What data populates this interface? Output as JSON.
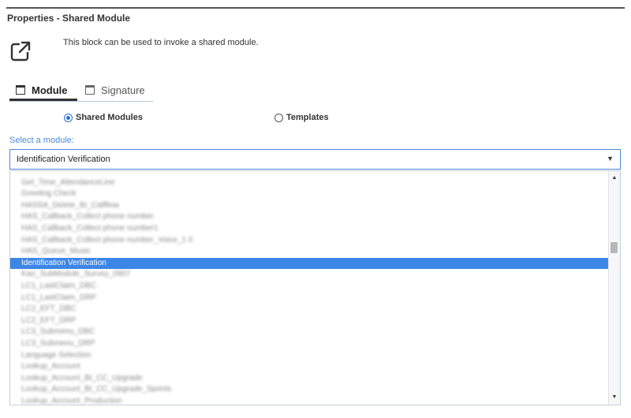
{
  "panel": {
    "title": "Properties - Shared Module",
    "description": "This block can be used to invoke a shared module."
  },
  "icons": {
    "header": "external-link-icon",
    "tab_module": "window-icon",
    "tab_signature": "window-icon"
  },
  "tabs": [
    {
      "label": "Module",
      "active": true
    },
    {
      "label": "Signature",
      "active": false
    }
  ],
  "radios": [
    {
      "label": "Shared Modules",
      "checked": true
    },
    {
      "label": "Templates",
      "checked": false
    }
  ],
  "select": {
    "label": "Select a module:",
    "value": "Identification Verification"
  },
  "list": {
    "items": [
      "",
      "Get_Time_AttendanceLine",
      "Greeting Check",
      "HASSA_Delete_BI_Callflow",
      "HAS_Callback_Collect phone number",
      "HAS_Callback_Collect phone number1",
      "HAS_Callback_Collect phone number_Voice_1 0",
      "HAS_Queue_Music",
      "Identification Verification",
      "Kari_SubModule_Survey_0907",
      "LC1_LastClaim_DBC",
      "LC1_LastClaim_DRP",
      "LC2_EFT_DBC",
      "LC2_EFT_DRP",
      "LC3_Submenu_DBC",
      "LC3_Submenu_DRP",
      "Language Selection",
      "Lookup_Account",
      "Lookup_Account_BI_CC_Upgrade",
      "Lookup_Account_BI_CC_Upgrade_Sprints",
      "Lookup_Account_Production"
    ],
    "selected_index": 8
  },
  "colors": {
    "accent": "#4a89dc",
    "selection": "#3c86e6"
  }
}
